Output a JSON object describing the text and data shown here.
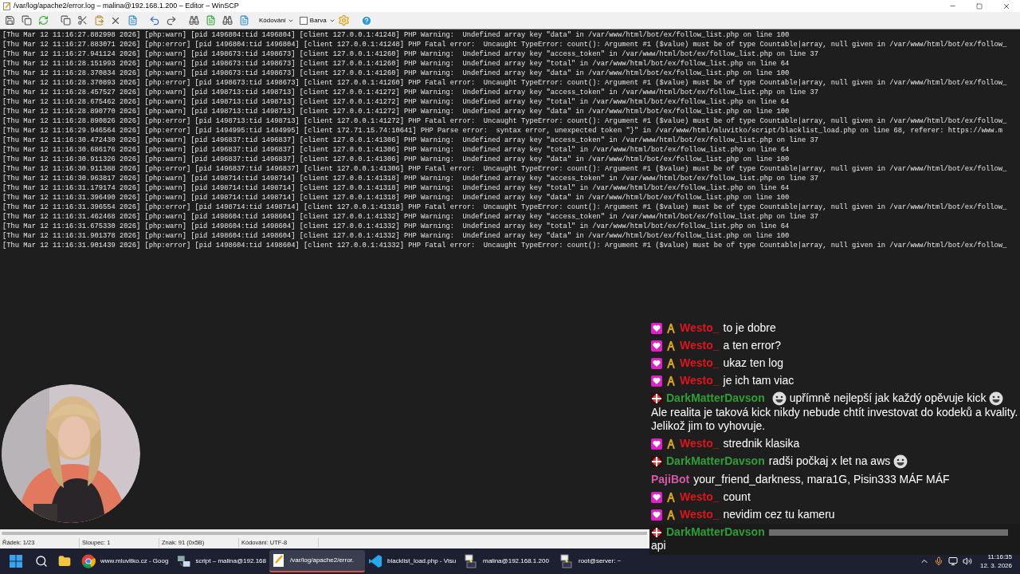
{
  "window": {
    "title": "/var/log/apache2/error.log – malina@192.168.1.200 – Editor – WinSCP"
  },
  "toolbar": {
    "encoding_menu": "Kódování",
    "color_option": {
      "label": "Barva",
      "checked": false
    }
  },
  "log_lines": [
    "[Thu Mar 12 11:16:27.882998 2026] [php:warn] [pid 1496804:tid 1496804] [client 127.0.0.1:41248] PHP Warning:  Undefined array key \"data\" in /var/www/html/bot/ex/follow_list.php on line 100",
    "[Thu Mar 12 11:16:27.883071 2026] [php:error] [pid 1496804:tid 1496804] [client 127.0.0.1:41248] PHP Fatal error:  Uncaught TypeError: count(): Argument #1 ($value) must be of type Countable|array, null given in /var/www/html/bot/ex/follow_",
    "[Thu Mar 12 11:16:27.941124 2026] [php:warn] [pid 1498673:tid 1498673] [client 127.0.0.1:41260] PHP Warning:  Undefined array key \"access_token\" in /var/www/html/bot/ex/follow_list.php on line 37",
    "[Thu Mar 12 11:16:28.151993 2026] [php:warn] [pid 1498673:tid 1498673] [client 127.0.0.1:41260] PHP Warning:  Undefined array key \"total\" in /var/www/html/bot/ex/follow_list.php on line 64",
    "[Thu Mar 12 11:16:28.370834 2026] [php:warn] [pid 1498673:tid 1498673] [client 127.0.0.1:41260] PHP Warning:  Undefined array key \"data\" in /var/www/html/bot/ex/follow_list.php on line 100",
    "[Thu Mar 12 11:16:28.370893 2026] [php:error] [pid 1498673:tid 1498673] [client 127.0.0.1:41260] PHP Fatal error:  Uncaught TypeError: count(): Argument #1 ($value) must be of type Countable|array, null given in /var/www/html/bot/ex/follow_",
    "[Thu Mar 12 11:16:28.457527 2026] [php:warn] [pid 1498713:tid 1498713] [client 127.0.0.1:41272] PHP Warning:  Undefined array key \"access_token\" in /var/www/html/bot/ex/follow_list.php on line 37",
    "[Thu Mar 12 11:16:28.675462 2026] [php:warn] [pid 1498713:tid 1498713] [client 127.0.0.1:41272] PHP Warning:  Undefined array key \"total\" in /var/www/html/bot/ex/follow_list.php on line 64",
    "[Thu Mar 12 11:16:28.890770 2026] [php:warn] [pid 1498713:tid 1498713] [client 127.0.0.1:41272] PHP Warning:  Undefined array key \"data\" in /var/www/html/bot/ex/follow_list.php on line 100",
    "[Thu Mar 12 11:16:28.890826 2026] [php:error] [pid 1498713:tid 1498713] [client 127.0.0.1:41272] PHP Fatal error:  Uncaught TypeError: count(): Argument #1 ($value) must be of type Countable|array, null given in /var/www/html/bot/ex/follow_",
    "[Thu Mar 12 11:16:29.946564 2026] [php:error] [pid 1494995:tid 1494995] [client 172.71.15.74:10641] PHP Parse error:  syntax error, unexpected token \"}\" in /var/www/html/mluvitko/script/blacklist_load.php on line 68, referer: https://www.m",
    "[Thu Mar 12 11:16:30.472430 2026] [php:warn] [pid 1496837:tid 1496837] [client 127.0.0.1:41306] PHP Warning:  Undefined array key \"access_token\" in /var/www/html/bot/ex/follow_list.php on line 37",
    "[Thu Mar 12 11:16:30.686176 2026] [php:warn] [pid 1496837:tid 1496837] [client 127.0.0.1:41306] PHP Warning:  Undefined array key \"total\" in /var/www/html/bot/ex/follow_list.php on line 64",
    "[Thu Mar 12 11:16:30.911326 2026] [php:warn] [pid 1496837:tid 1496837] [client 127.0.0.1:41306] PHP Warning:  Undefined array key \"data\" in /var/www/html/bot/ex/follow_list.php on line 100",
    "[Thu Mar 12 11:16:30.911388 2026] [php:error] [pid 1496837:tid 1496837] [client 127.0.0.1:41306] PHP Fatal error:  Uncaught TypeError: count(): Argument #1 ($value) must be of type Countable|array, null given in /var/www/html/bot/ex/follow_",
    "[Thu Mar 12 11:16:30.963817 2026] [php:warn] [pid 1498714:tid 1498714] [client 127.0.0.1:41318] PHP Warning:  Undefined array key \"access_token\" in /var/www/html/bot/ex/follow_list.php on line 37",
    "[Thu Mar 12 11:16:31.179174 2026] [php:warn] [pid 1498714:tid 1498714] [client 127.0.0.1:41318] PHP Warning:  Undefined array key \"total\" in /var/www/html/bot/ex/follow_list.php on line 64",
    "[Thu Mar 12 11:16:31.396490 2026] [php:warn] [pid 1498714:tid 1498714] [client 127.0.0.1:41318] PHP Warning:  Undefined array key \"data\" in /var/www/html/bot/ex/follow_list.php on line 100",
    "[Thu Mar 12 11:16:31.396554 2026] [php:error] [pid 1498714:tid 1498714] [client 127.0.0.1:41318] PHP Fatal error:  Uncaught TypeError: count(): Argument #1 ($value) must be of type Countable|array, null given in /var/www/html/bot/ex/follow_",
    "[Thu Mar 12 11:16:31.462468 2026] [php:warn] [pid 1498604:tid 1498604] [client 127.0.0.1:41332] PHP Warning:  Undefined array key \"access_token\" in /var/www/html/bot/ex/follow_list.php on line 37",
    "[Thu Mar 12 11:16:31.675330 2026] [php:warn] [pid 1498604:tid 1498604] [client 127.0.0.1:41332] PHP Warning:  Undefined array key \"total\" in /var/www/html/bot/ex/follow_list.php on line 64",
    "[Thu Mar 12 11:16:31.901378 2026] [php:warn] [pid 1498604:tid 1498604] [client 127.0.0.1:41332] PHP Warning:  Undefined array key \"data\" in /var/www/html/bot/ex/follow_list.php on line 100",
    "[Thu Mar 12 11:16:31.901439 2026] [php:error] [pid 1498604:tid 1498604] [client 127.0.0.1:41332] PHP Fatal error:  Uncaught TypeError: count(): Argument #1 ($value) must be of type Countable|array, null given in /var/www/html/bot/ex/follow_"
  ],
  "status_bar": [
    "Řádek: 1/23",
    "Sloupec: 1",
    "Znak: 91 (0x5B)",
    "Kódování: UTF-8"
  ],
  "chat": [
    {
      "user": "Westo_",
      "color": "#e0141b",
      "kind": "subscriber",
      "segments": [
        {
          "kind": "text",
          "text": "to je dobre"
        }
      ]
    },
    {
      "user": "Westo_",
      "color": "#e0141b",
      "kind": "subscriber",
      "segments": [
        {
          "kind": "text",
          "text": "a ten error?"
        }
      ]
    },
    {
      "user": "Westo_",
      "color": "#e0141b",
      "kind": "subscriber",
      "segments": [
        {
          "kind": "text",
          "text": "ukaz ten log"
        }
      ]
    },
    {
      "user": "Westo_",
      "color": "#e0141b",
      "kind": "subscriber",
      "segments": [
        {
          "kind": "text",
          "text": "je ich tam viac"
        }
      ]
    },
    {
      "user": "DarkMatterDavson",
      "color": "#2f9e36",
      "kind": "skull",
      "segments": [
        {
          "kind": "emote"
        },
        {
          "kind": "text",
          "text": "upřímně nejlepší jak každý opěvuje kick"
        },
        {
          "kind": "emote"
        },
        {
          "kind": "text",
          "text": "Ale realita je taková kick nikdy nebude chtít investovat do kodeků a kvality. Jelikož jim to vyhovuje."
        }
      ]
    },
    {
      "user": "Westo_",
      "color": "#e0141b",
      "kind": "subscriber",
      "segments": [
        {
          "kind": "text",
          "text": "strednik klasika"
        }
      ]
    },
    {
      "user": "DarkMatterDavson",
      "color": "#2f9e36",
      "kind": "skull",
      "segments": [
        {
          "kind": "text",
          "text": "radši počkaj x let na aws"
        },
        {
          "kind": "emote"
        }
      ]
    },
    {
      "user": "PajiBot",
      "color": "#d659a8",
      "kind": "plain",
      "segments": [
        {
          "kind": "text",
          "text": "your_friend_darkness, mara1G, Pisin333 MÁF MÁF"
        }
      ]
    },
    {
      "user": "Westo_",
      "color": "#e0141b",
      "kind": "subscriber",
      "segments": [
        {
          "kind": "text",
          "text": "count"
        }
      ]
    },
    {
      "user": "Westo_",
      "color": "#e0141b",
      "kind": "subscriber",
      "segments": [
        {
          "kind": "text",
          "text": "nevidim cez tu kameru"
        }
      ]
    },
    {
      "user": "DarkMatterDavson",
      "color": "#2f9e36",
      "kind": "skull",
      "segments": [
        {
          "kind": "blur"
        },
        {
          "kind": "text",
          "text": "api"
        }
      ]
    }
  ],
  "taskbar": {
    "items": [
      {
        "kind": "chrome",
        "label": "www.mluvitko.cz - Goog",
        "selected": false
      },
      {
        "kind": "winscp",
        "label": "script – malina@192.168",
        "selected": false
      },
      {
        "kind": "editor",
        "label": "/var/log/apache2/error.",
        "selected": true
      },
      {
        "kind": "vscode",
        "label": "blacklist_load.php - Visu",
        "selected": false
      },
      {
        "kind": "putty",
        "label": "malina@192.168.1.200",
        "selected": false
      },
      {
        "kind": "putty",
        "label": "root@server: ~",
        "selected": false
      }
    ],
    "time": "11:16:35",
    "date": "12. 3. 2026"
  }
}
